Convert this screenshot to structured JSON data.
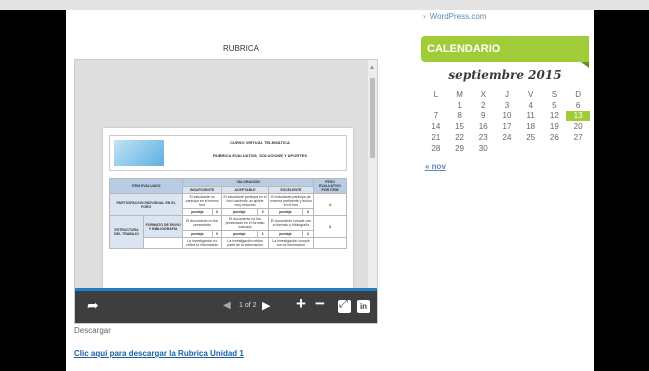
{
  "sidebar": {
    "wp_link": "WordPress.com",
    "calendar": {
      "title": "CALENDARIO",
      "month": "septiembre 2015",
      "weekdays": [
        "L",
        "M",
        "X",
        "J",
        "V",
        "S",
        "D"
      ],
      "weeks": [
        [
          "",
          "1",
          "2",
          "3",
          "4",
          "5",
          "6"
        ],
        [
          "7",
          "8",
          "9",
          "10",
          "11",
          "12",
          "13"
        ],
        [
          "14",
          "15",
          "16",
          "17",
          "18",
          "19",
          "20"
        ],
        [
          "21",
          "22",
          "23",
          "24",
          "25",
          "26",
          "27"
        ],
        [
          "28",
          "29",
          "30",
          "",
          "",
          "",
          ""
        ]
      ],
      "today": "13",
      "prev_link": "« nov"
    }
  },
  "main": {
    "doc_title": "RUBRICA",
    "viewer": {
      "page_indicator": "1 of 2",
      "doc_header_a": "CURSO VIRTUAL TELEMÁTICA",
      "doc_header_b": "RUBRICA EVALUATIVA_SOLUCIONE Y APORTES",
      "table": {
        "col1": "ITEM EVALUADO",
        "valuation": "VALORACION",
        "c_insuf": "INSUFICIENTE",
        "c_acept": "ACEPTABLE",
        "c_excel": "EXCELENTE",
        "c_peso": "PESO EVALUATIVO POR ITEM",
        "row1": "PARTICIPACION INDIVIDUAL EN EL FORO",
        "row2": "FORMATO DE ENVIO Y BIBLIOGRAFIA",
        "row3": "ESTRUCTURA DEL TRABAJO",
        "puntaje": "puntaje",
        "p0": "0",
        "p2": "2",
        "p1": "1",
        "p3": "3",
        "w4": "4",
        "w3": "3",
        "t_insuf": "El estudiante no participa en el mismo foro",
        "t_acept": "El estudiante participa en el foro haciendo un aporte muy reducido",
        "t_excel": "El estudiante participa de manera pertinente y activa en el foro",
        "t_insuf2": "El documento no fue presentado",
        "t_acept2": "El documento no fue presentado en el formato indicado",
        "t_excel2": "El documento cumple con el formato y bibliografía",
        "t_insuf3": "La investigación no critica la información",
        "t_acept3": "La investigación critica parte de la información",
        "t_excel3": "La investigación cumple con la información"
      }
    },
    "download_label": "Descargar",
    "download_link": "Clic aquí para descargar la Rubrica Unidad 1"
  }
}
